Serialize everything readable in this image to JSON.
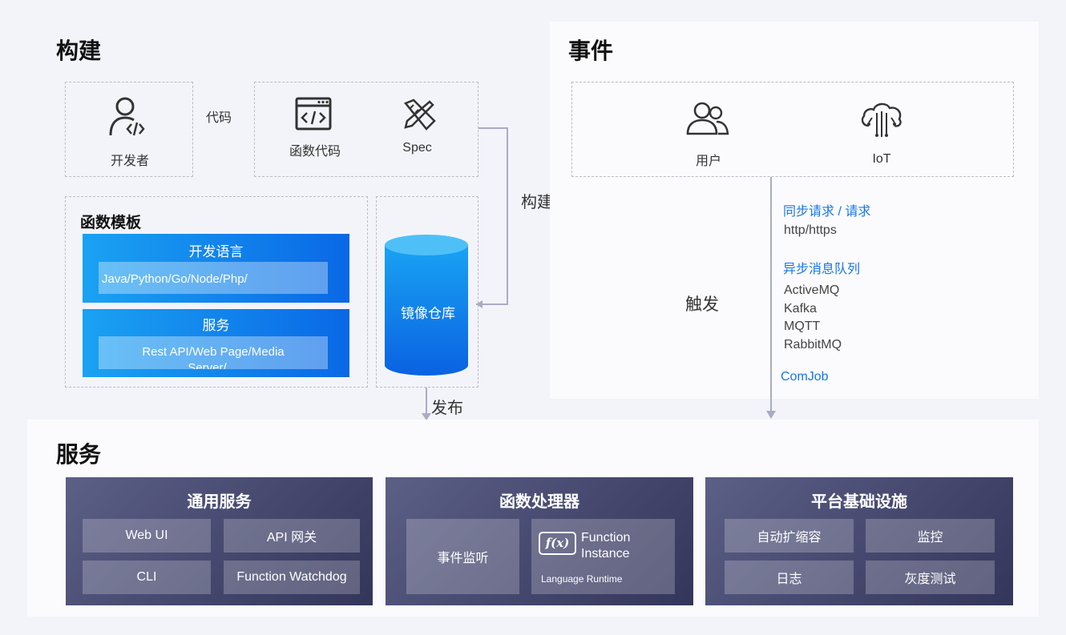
{
  "build": {
    "title": "构建",
    "developer_label": "开发者",
    "code_label": "代码",
    "func_code_label": "函数代码",
    "spec_label": "Spec",
    "build_arrow_label": "构建",
    "template_title": "函数模板",
    "lang_title": "开发语言",
    "lang_value": "Java/Python/Go/Node/Php/\n…",
    "service_title": "服务",
    "service_value": "Rest API/Web Page/Media\nServer/…",
    "repo_label": "镜像仓库",
    "publish_label": "发布"
  },
  "event": {
    "title": "事件",
    "user_label": "用户",
    "iot_label": "IoT",
    "trigger_label": "触发",
    "sync_title": "同步请求 / 请求",
    "sync_value": "http/https",
    "async_title": "异步消息队列",
    "mq_list": [
      "ActiveMQ",
      "Kafka",
      "MQTT",
      "RabbitMQ"
    ],
    "cronjob": "ComJob"
  },
  "services": {
    "title": "服务",
    "common": {
      "title": "通用服务",
      "items": [
        "Web UI",
        "API 网关",
        "CLI",
        "Function Watchdog"
      ]
    },
    "processor": {
      "title": "函数处理器",
      "event_monitor": "事件监听",
      "fx_icon_text": "f(x)",
      "function_instance": "Function\nInstance",
      "language_runtime": "Language Runtime"
    },
    "platform": {
      "title": "平台基础设施",
      "items": [
        "自动扩缩容",
        "监控",
        "日志",
        "灰度测试"
      ]
    }
  },
  "colors": {
    "accent_blue": "#1677e8",
    "card_dark": "#3d3f66",
    "arrow": "#a9abc6"
  }
}
